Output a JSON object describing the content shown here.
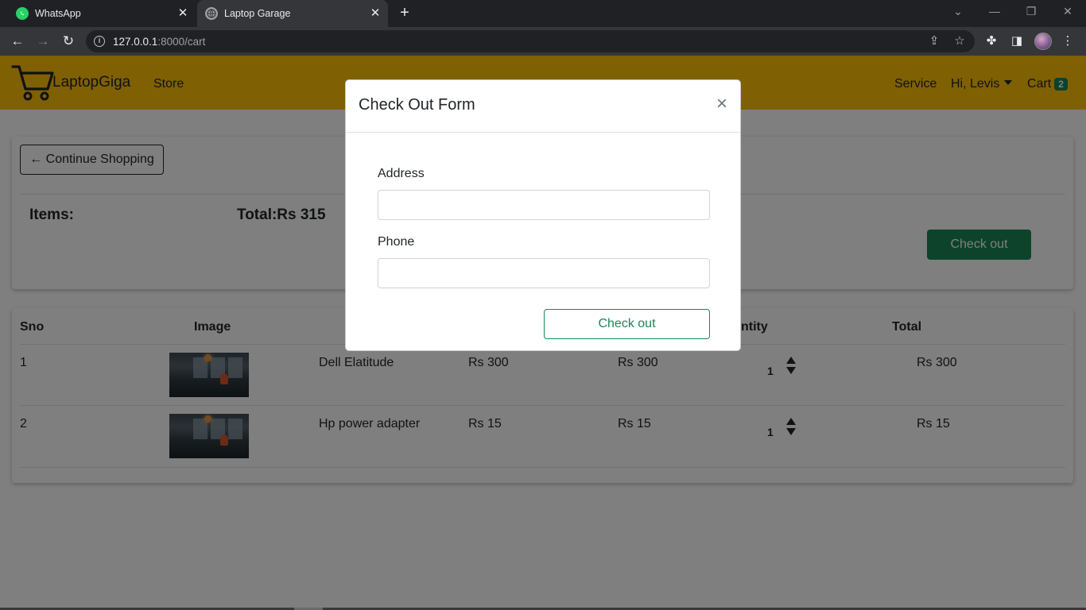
{
  "browser": {
    "tabs": [
      {
        "title": "WhatsApp",
        "icon": "whatsapp-icon"
      },
      {
        "title": "Laptop Garage",
        "icon": "globe-icon"
      }
    ],
    "new_tab_icon": "plus-icon",
    "url_host": "127.0.0.1",
    "url_rest": ":8000/cart"
  },
  "navbar": {
    "brand": "LaptopGiga",
    "store": "Store",
    "service": "Service",
    "user": "Hi, Levis",
    "cart_label": "Cart",
    "cart_count": "2",
    "bg_color": "#ffc107"
  },
  "summary": {
    "continue_label": "← Continue Shopping",
    "items_label": "Items:",
    "total_label": "Total:Rs 315",
    "checkout_label": "Check out"
  },
  "table": {
    "headers": [
      "Sno",
      "Image",
      "ntity",
      "Total"
    ],
    "rows": [
      {
        "sno": "1",
        "name": "Dell Elatitude",
        "price": "Rs 300",
        "subtotal": "Rs 300",
        "qty": "1",
        "total": "Rs 300"
      },
      {
        "sno": "2",
        "name": "Hp power adapter",
        "price": "Rs 15",
        "subtotal": "Rs 15",
        "qty": "1",
        "total": "Rs 15"
      }
    ]
  },
  "modal": {
    "title": "Check Out Form",
    "address_label": "Address",
    "address_value": "",
    "phone_label": "Phone",
    "phone_value": "",
    "submit_label": "Check out"
  },
  "colors": {
    "success": "#198754",
    "warning": "#ffc107"
  }
}
